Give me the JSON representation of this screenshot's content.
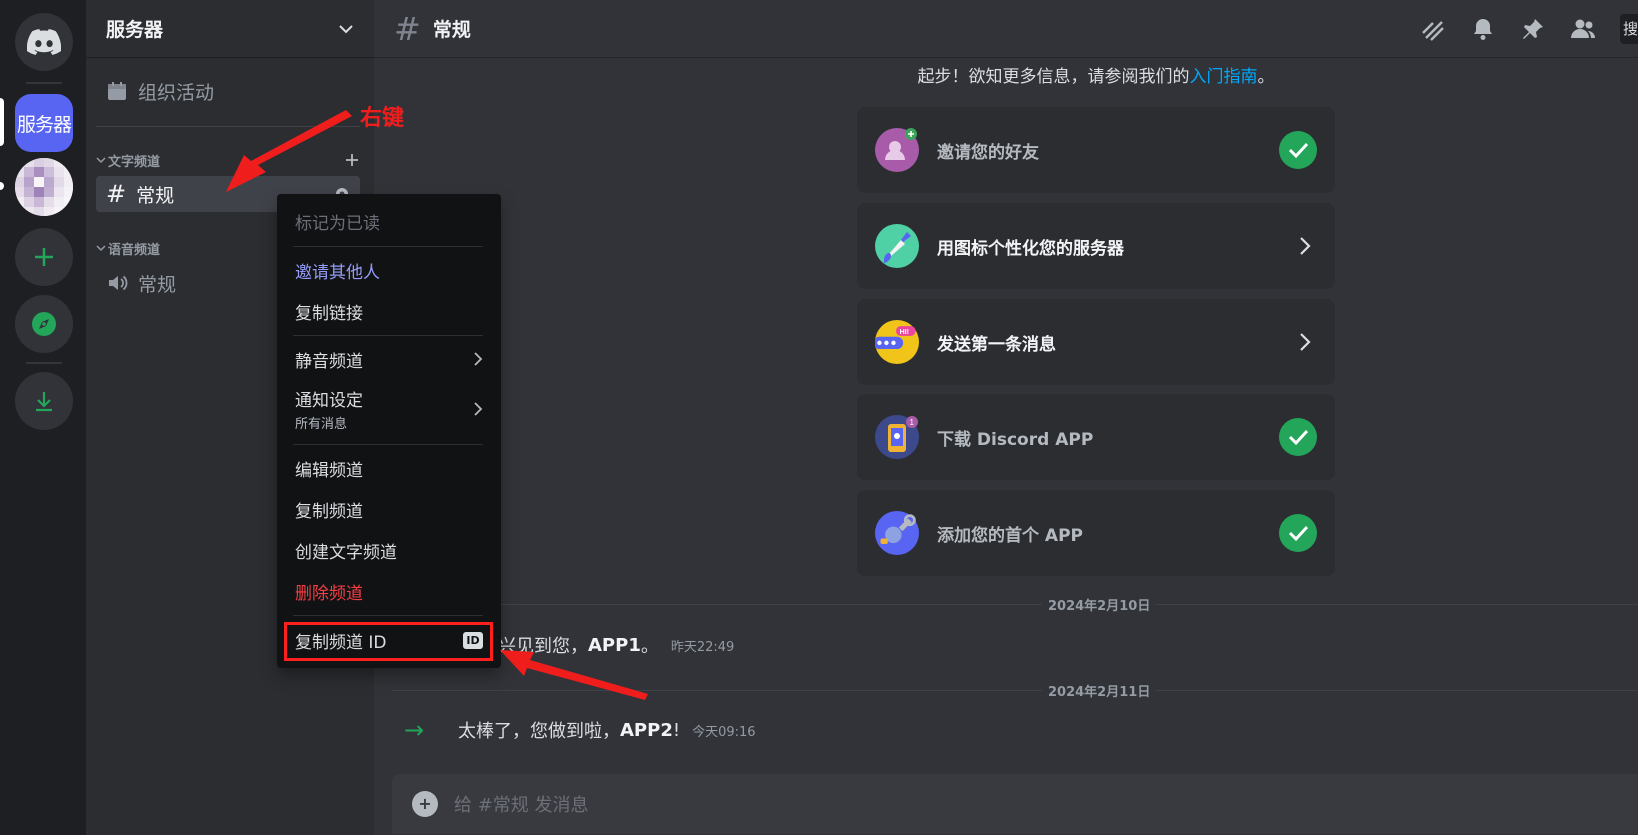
{
  "server_rail": {
    "active_server_label": "服务器"
  },
  "sidebar": {
    "server_name": "服务器",
    "events_label": "组织活动",
    "text_category": "文字频道",
    "voice_category": "语音频道",
    "text_channel": "常规",
    "voice_channel": "常规"
  },
  "header": {
    "channel_name": "常规",
    "search_stub": "搜"
  },
  "main": {
    "intro_text": "起步！欲知更多信息，请参阅我们的",
    "intro_link": "入门指南",
    "intro_end": "。",
    "cards": [
      {
        "label": "邀请您的好友",
        "status": "done",
        "icon": "invite-friends-icon"
      },
      {
        "label": "用图标个性化您的服务器",
        "status": "todo",
        "icon": "paint-brush-icon"
      },
      {
        "label": "发送第一条消息",
        "status": "todo",
        "icon": "chat-bubble-icon"
      },
      {
        "label": "下载 Discord APP",
        "status": "done",
        "icon": "phone-download-icon"
      },
      {
        "label": "添加您的首个 APP",
        "status": "done",
        "icon": "wrench-app-icon"
      }
    ],
    "date_1": "2024年2月10日",
    "date_2": "2024年2月11日",
    "msg1": {
      "prefix": "兴见到您，",
      "name": "APP1",
      "suffix": "。",
      "time": "昨天22:49"
    },
    "msg2": {
      "prefix": "太棒了，您做到啦，",
      "name": "APP2",
      "suffix": "!",
      "time": "今天09:16"
    },
    "composer_placeholder": "给 #常规 发消息"
  },
  "context_menu": {
    "mark_read": "标记为已读",
    "invite": "邀请其他人",
    "copy_link": "复制链接",
    "mute": "静音频道",
    "notify": "通知设定",
    "notify_sub": "所有消息",
    "edit": "编辑频道",
    "duplicate": "复制频道",
    "create_text": "创建文字频道",
    "delete": "删除频道",
    "copy_id": "复制频道 ID",
    "id_badge": "ID"
  },
  "annotation": {
    "right_click_note": "右键"
  },
  "colors": {
    "blurple": "#5865f2",
    "green": "#23a55a",
    "danger": "#f23f43",
    "annotation_red": "#ff1f1f"
  }
}
